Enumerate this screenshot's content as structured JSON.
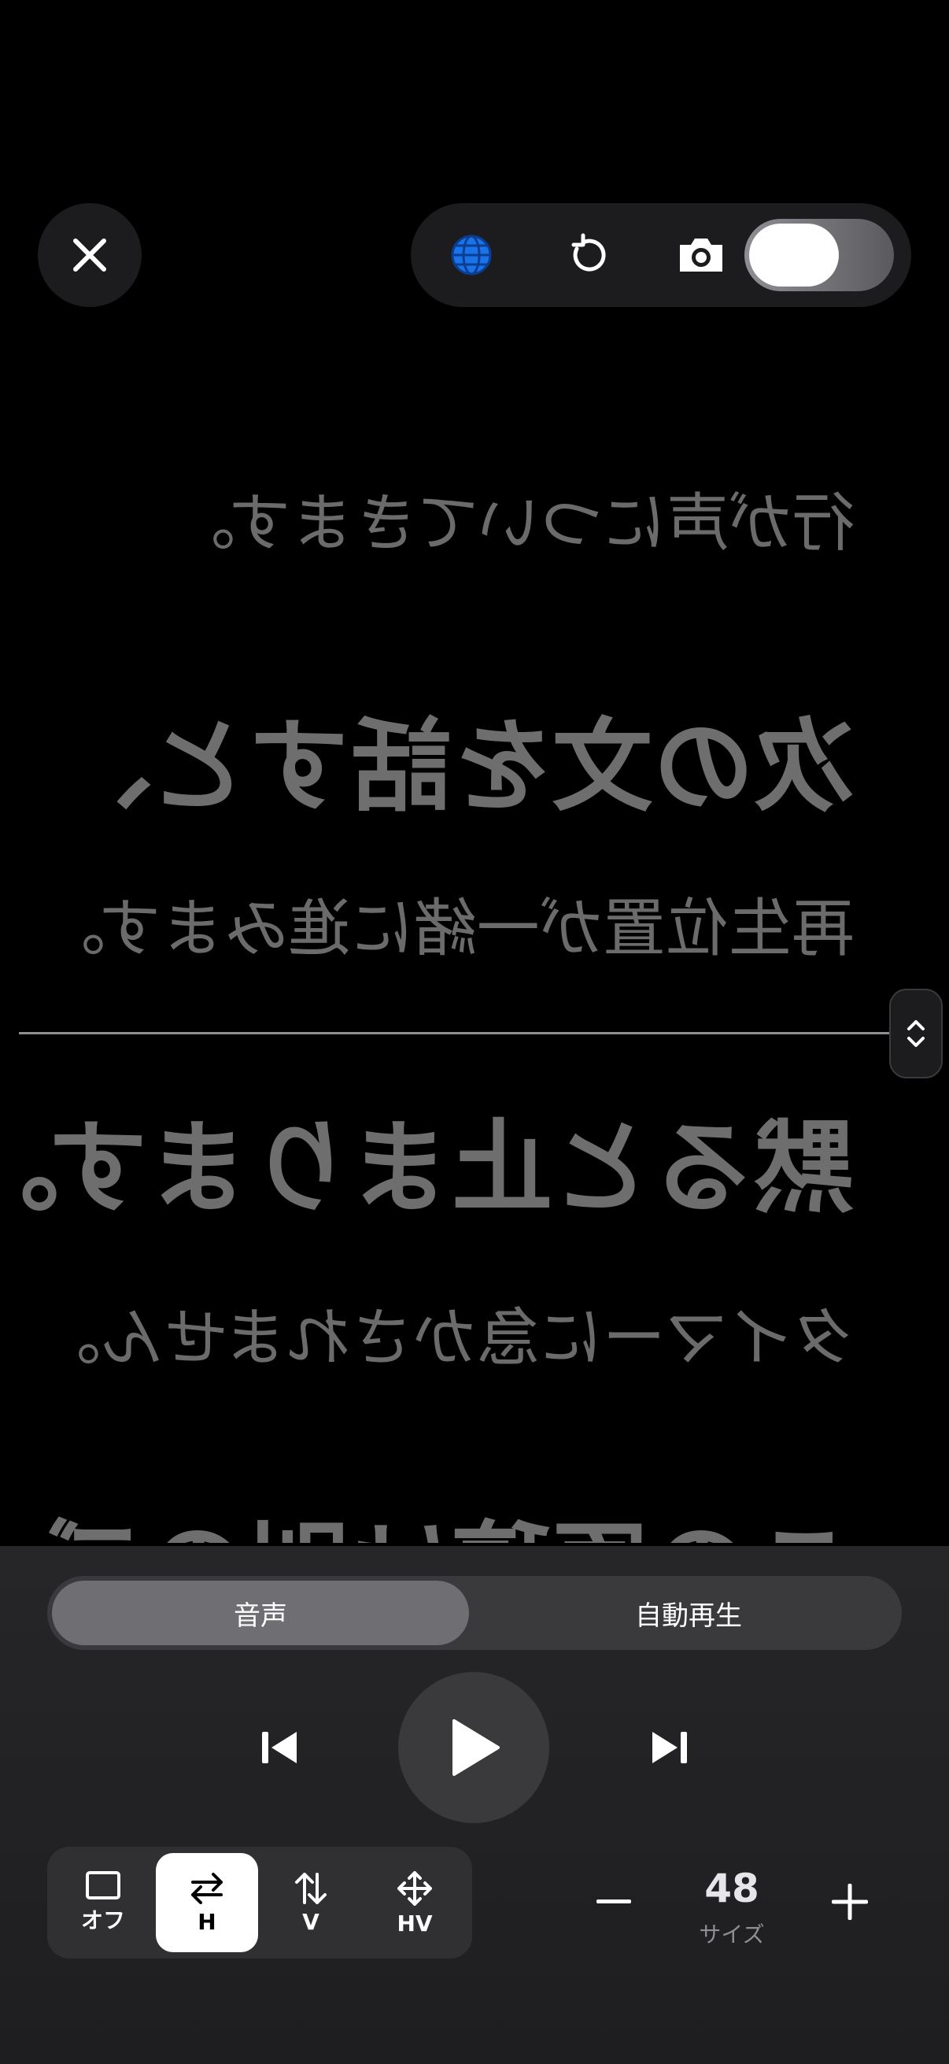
{
  "top_bar": {
    "close_icon": "close-icon",
    "globe_icon": "globe-icon",
    "rotate_icon": "rotate-icon",
    "camera_icon": "camera-icon",
    "camera_toggle_on": false,
    "accent_color": "#1a73e8"
  },
  "prompter": {
    "mirrored": true,
    "lines": [
      {
        "text": "行が声についてきます。",
        "size": "small"
      },
      {
        "text": "次の文を話すと、",
        "size": "big"
      },
      {
        "text": "再生位置が一緒に進みます。",
        "size": "small"
      },
      {
        "text": "黙ると止まります。",
        "size": "big"
      },
      {
        "text": "タイマーに急かされません。",
        "size": "small"
      },
      {
        "text": "この原稿は別のデータ",
        "size": "big"
      }
    ]
  },
  "mode_segment": {
    "options": [
      "音声",
      "自動再生"
    ],
    "selected": "音声"
  },
  "playback": {
    "prev_icon": "skip-back-icon",
    "play_icon": "play-icon",
    "next_icon": "skip-forward-icon"
  },
  "mirror": {
    "options": [
      {
        "label": "オフ",
        "icon": "square-icon"
      },
      {
        "label": "H",
        "icon": "horizontal-arrows-icon"
      },
      {
        "label": "V",
        "icon": "vertical-arrows-icon"
      },
      {
        "label": "HV",
        "icon": "move-arrows-icon"
      }
    ],
    "selected": "H"
  },
  "font_size": {
    "value": "48",
    "caption": "サイズ",
    "minus_icon": "minus-icon",
    "plus_icon": "plus-icon"
  }
}
